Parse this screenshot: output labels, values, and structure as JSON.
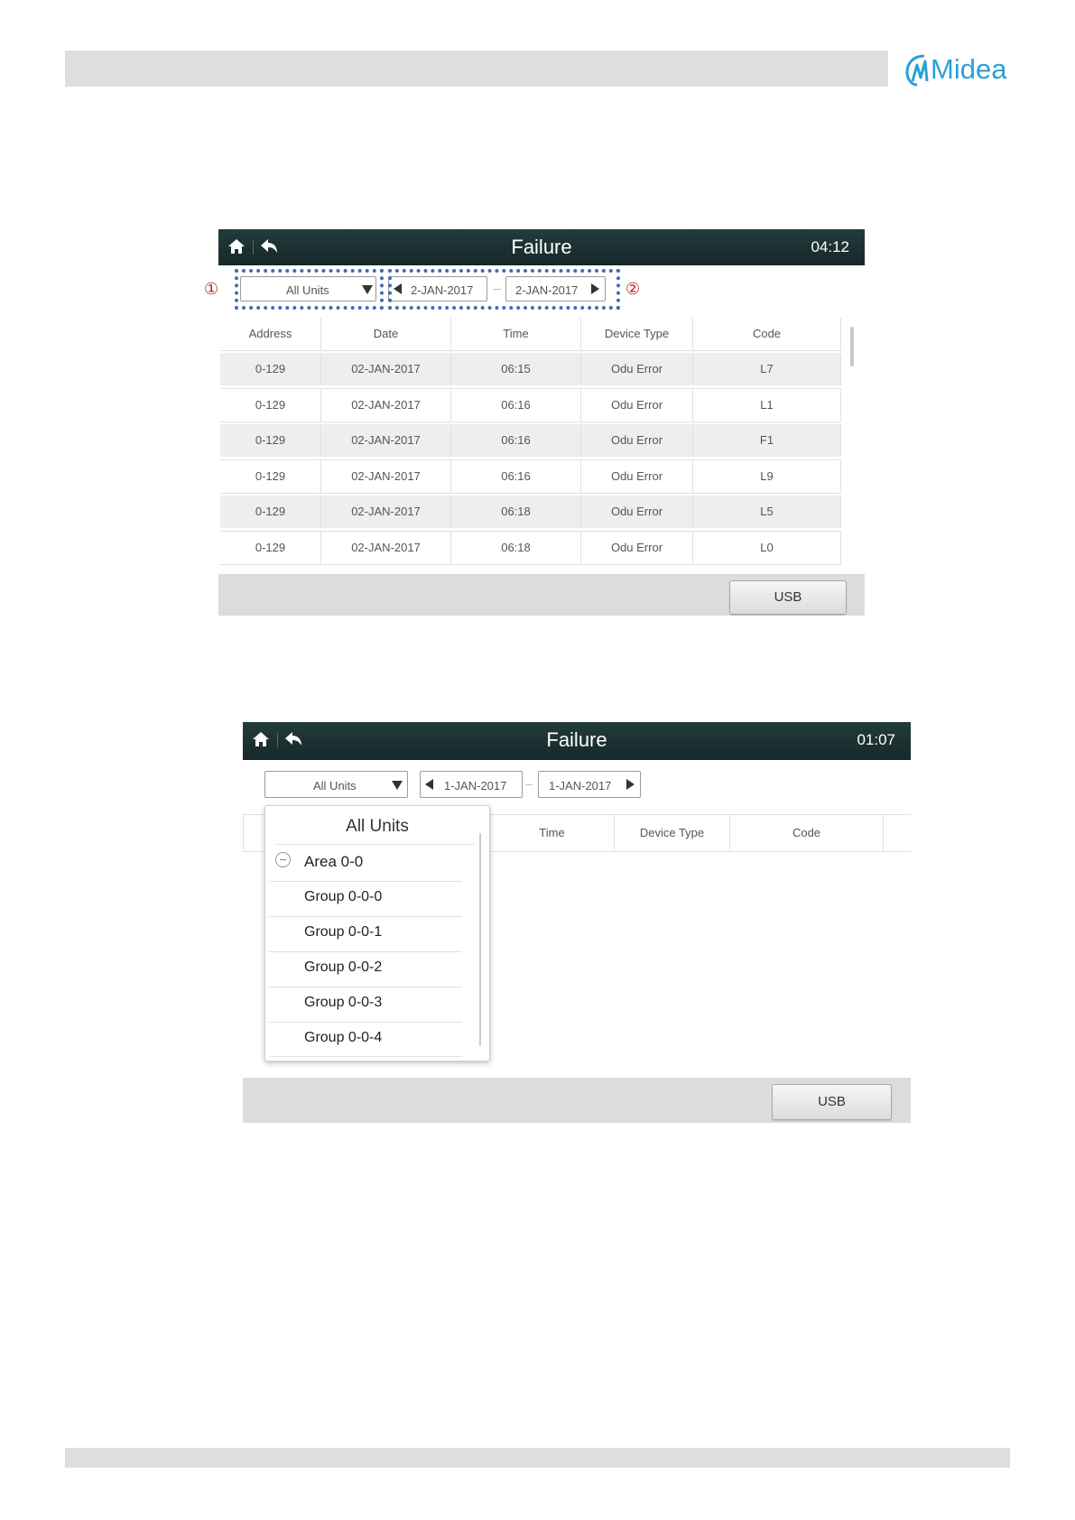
{
  "page": {
    "logo_text": "Midea"
  },
  "screen1": {
    "title": "Failure",
    "clock": "04:12",
    "unit_filter": "All Units",
    "date_from": "2-JAN-2017",
    "date_to": "2-JAN-2017",
    "marker1": "①",
    "marker2": "②",
    "columns": [
      "Address",
      "Date",
      "Time",
      "Device Type",
      "Code"
    ],
    "rows": [
      [
        "0-129",
        "02-JAN-2017",
        "06:15",
        "Odu Error",
        "L7"
      ],
      [
        "0-129",
        "02-JAN-2017",
        "06:16",
        "Odu Error",
        "L1"
      ],
      [
        "0-129",
        "02-JAN-2017",
        "06:16",
        "Odu Error",
        "F1"
      ],
      [
        "0-129",
        "02-JAN-2017",
        "06:16",
        "Odu Error",
        "L9"
      ],
      [
        "0-129",
        "02-JAN-2017",
        "06:18",
        "Odu Error",
        "L5"
      ],
      [
        "0-129",
        "02-JAN-2017",
        "06:18",
        "Odu Error",
        "L0"
      ]
    ],
    "usb_label": "USB"
  },
  "screen2": {
    "title": "Failure",
    "clock": "01:07",
    "unit_filter": "All Units",
    "date_from": "1-JAN-2017",
    "date_to": "1-JAN-2017",
    "columns_visible": [
      "Time",
      "Device Type",
      "Code"
    ],
    "usb_label": "USB",
    "dropdown": {
      "title": "All Units",
      "area": "Area 0-0",
      "groups": [
        "Group 0-0-0",
        "Group 0-0-1",
        "Group 0-0-2",
        "Group 0-0-3",
        "Group 0-0-4"
      ]
    }
  },
  "colors": {
    "topbar": "#1c3032",
    "accent_blue": "#3e6fae",
    "logo_blue": "#2aa0d8",
    "marker_red": "#b22222"
  }
}
